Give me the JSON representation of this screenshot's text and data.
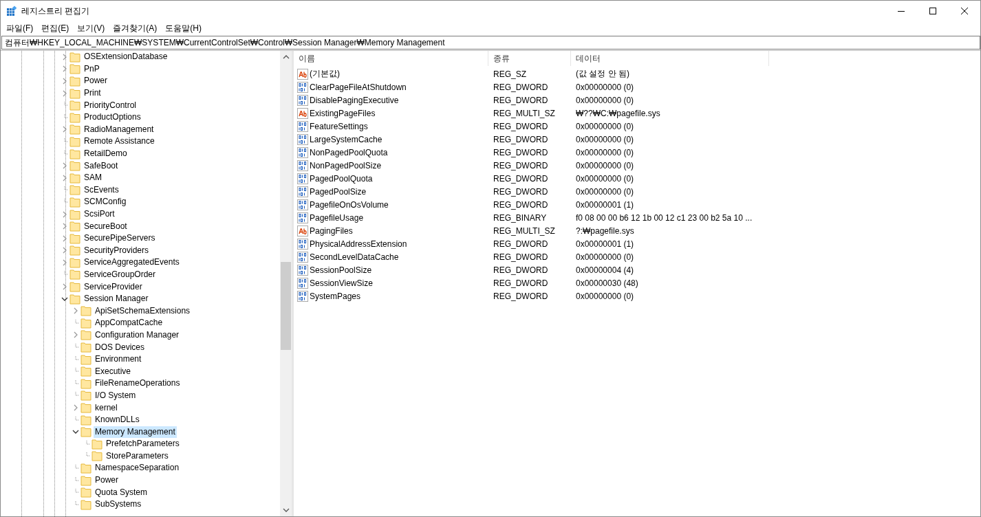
{
  "window": {
    "title": "레지스트리 편집기"
  },
  "menu": [
    "파일(F)",
    "편집(E)",
    "보기(V)",
    "즐겨찾기(A)",
    "도움말(H)"
  ],
  "address": {
    "value": "컴퓨터₩HKEY_LOCAL_MACHINE₩SYSTEM₩CurrentControlSet₩Control₩Session Manager₩Memory Management"
  },
  "tree": {
    "items": [
      {
        "name": "OSExtensionDatabase",
        "expandable": true,
        "expanded": false,
        "selected": false
      },
      {
        "name": "PnP",
        "expandable": true,
        "expanded": false,
        "selected": false
      },
      {
        "name": "Power",
        "expandable": true,
        "expanded": false,
        "selected": false
      },
      {
        "name": "Print",
        "expandable": true,
        "expanded": false,
        "selected": false
      },
      {
        "name": "PriorityControl",
        "expandable": false,
        "selected": false
      },
      {
        "name": "ProductOptions",
        "expandable": false,
        "selected": false
      },
      {
        "name": "RadioManagement",
        "expandable": true,
        "expanded": false,
        "selected": false
      },
      {
        "name": "Remote Assistance",
        "expandable": false,
        "selected": false
      },
      {
        "name": "RetailDemo",
        "expandable": false,
        "selected": false
      },
      {
        "name": "SafeBoot",
        "expandable": true,
        "expanded": false,
        "selected": false
      },
      {
        "name": "SAM",
        "expandable": true,
        "expanded": false,
        "selected": false
      },
      {
        "name": "ScEvents",
        "expandable": false,
        "selected": false
      },
      {
        "name": "SCMConfig",
        "expandable": false,
        "selected": false
      },
      {
        "name": "ScsiPort",
        "expandable": true,
        "expanded": false,
        "selected": false
      },
      {
        "name": "SecureBoot",
        "expandable": true,
        "expanded": false,
        "selected": false
      },
      {
        "name": "SecurePipeServers",
        "expandable": true,
        "expanded": false,
        "selected": false
      },
      {
        "name": "SecurityProviders",
        "expandable": true,
        "expanded": false,
        "selected": false
      },
      {
        "name": "ServiceAggregatedEvents",
        "expandable": true,
        "expanded": false,
        "selected": false
      },
      {
        "name": "ServiceGroupOrder",
        "expandable": false,
        "selected": false
      },
      {
        "name": "ServiceProvider",
        "expandable": true,
        "expanded": false,
        "selected": false
      },
      {
        "name": "Session Manager",
        "expandable": true,
        "expanded": true,
        "selected": false,
        "children": [
          {
            "name": "ApiSetSchemaExtensions",
            "expandable": true,
            "expanded": false,
            "selected": false
          },
          {
            "name": "AppCompatCache",
            "expandable": false,
            "selected": false
          },
          {
            "name": "Configuration Manager",
            "expandable": true,
            "expanded": false,
            "selected": false
          },
          {
            "name": "DOS Devices",
            "expandable": false,
            "selected": false
          },
          {
            "name": "Environment",
            "expandable": false,
            "selected": false
          },
          {
            "name": "Executive",
            "expandable": false,
            "selected": false
          },
          {
            "name": "FileRenameOperations",
            "expandable": false,
            "selected": false
          },
          {
            "name": "I/O System",
            "expandable": false,
            "selected": false
          },
          {
            "name": "kernel",
            "expandable": true,
            "expanded": false,
            "selected": false
          },
          {
            "name": "KnownDLLs",
            "expandable": false,
            "selected": false
          },
          {
            "name": "Memory Management",
            "expandable": true,
            "expanded": true,
            "selected": true,
            "children": [
              {
                "name": "PrefetchParameters",
                "expandable": false,
                "selected": false
              },
              {
                "name": "StoreParameters",
                "expandable": false,
                "selected": false
              }
            ]
          },
          {
            "name": "NamespaceSeparation",
            "expandable": false,
            "selected": false
          },
          {
            "name": "Power",
            "expandable": false,
            "selected": false
          },
          {
            "name": "Quota System",
            "expandable": false,
            "selected": false
          },
          {
            "name": "SubSystems",
            "expandable": false,
            "selected": false
          }
        ]
      }
    ]
  },
  "values": {
    "columns": [
      "이름",
      "종류",
      "데이터"
    ],
    "rows": [
      {
        "kind": "string",
        "name": "(기본값)",
        "type": "REG_SZ",
        "data": "(값 설정 안 됨)"
      },
      {
        "kind": "binary",
        "name": "ClearPageFileAtShutdown",
        "type": "REG_DWORD",
        "data": "0x00000000 (0)"
      },
      {
        "kind": "binary",
        "name": "DisablePagingExecutive",
        "type": "REG_DWORD",
        "data": "0x00000000 (0)"
      },
      {
        "kind": "string",
        "name": "ExistingPageFiles",
        "type": "REG_MULTI_SZ",
        "data": "₩??₩C:₩pagefile.sys"
      },
      {
        "kind": "binary",
        "name": "FeatureSettings",
        "type": "REG_DWORD",
        "data": "0x00000000 (0)"
      },
      {
        "kind": "binary",
        "name": "LargeSystemCache",
        "type": "REG_DWORD",
        "data": "0x00000000 (0)"
      },
      {
        "kind": "binary",
        "name": "NonPagedPoolQuota",
        "type": "REG_DWORD",
        "data": "0x00000000 (0)"
      },
      {
        "kind": "binary",
        "name": "NonPagedPoolSize",
        "type": "REG_DWORD",
        "data": "0x00000000 (0)"
      },
      {
        "kind": "binary",
        "name": "PagedPoolQuota",
        "type": "REG_DWORD",
        "data": "0x00000000 (0)"
      },
      {
        "kind": "binary",
        "name": "PagedPoolSize",
        "type": "REG_DWORD",
        "data": "0x00000000 (0)"
      },
      {
        "kind": "binary",
        "name": "PagefileOnOsVolume",
        "type": "REG_DWORD",
        "data": "0x00000001 (1)"
      },
      {
        "kind": "binary",
        "name": "PagefileUsage",
        "type": "REG_BINARY",
        "data": "f0 08 00 00 b6 12 1b 00 12 c1 23 00 b2 5a 10 ..."
      },
      {
        "kind": "string",
        "name": "PagingFiles",
        "type": "REG_MULTI_SZ",
        "data": "?:₩pagefile.sys"
      },
      {
        "kind": "binary",
        "name": "PhysicalAddressExtension",
        "type": "REG_DWORD",
        "data": "0x00000001 (1)"
      },
      {
        "kind": "binary",
        "name": "SecondLevelDataCache",
        "type": "REG_DWORD",
        "data": "0x00000000 (0)"
      },
      {
        "kind": "binary",
        "name": "SessionPoolSize",
        "type": "REG_DWORD",
        "data": "0x00000004 (4)"
      },
      {
        "kind": "binary",
        "name": "SessionViewSize",
        "type": "REG_DWORD",
        "data": "0x00000030 (48)"
      },
      {
        "kind": "binary",
        "name": "SystemPages",
        "type": "REG_DWORD",
        "data": "0x00000000 (0)"
      }
    ]
  }
}
